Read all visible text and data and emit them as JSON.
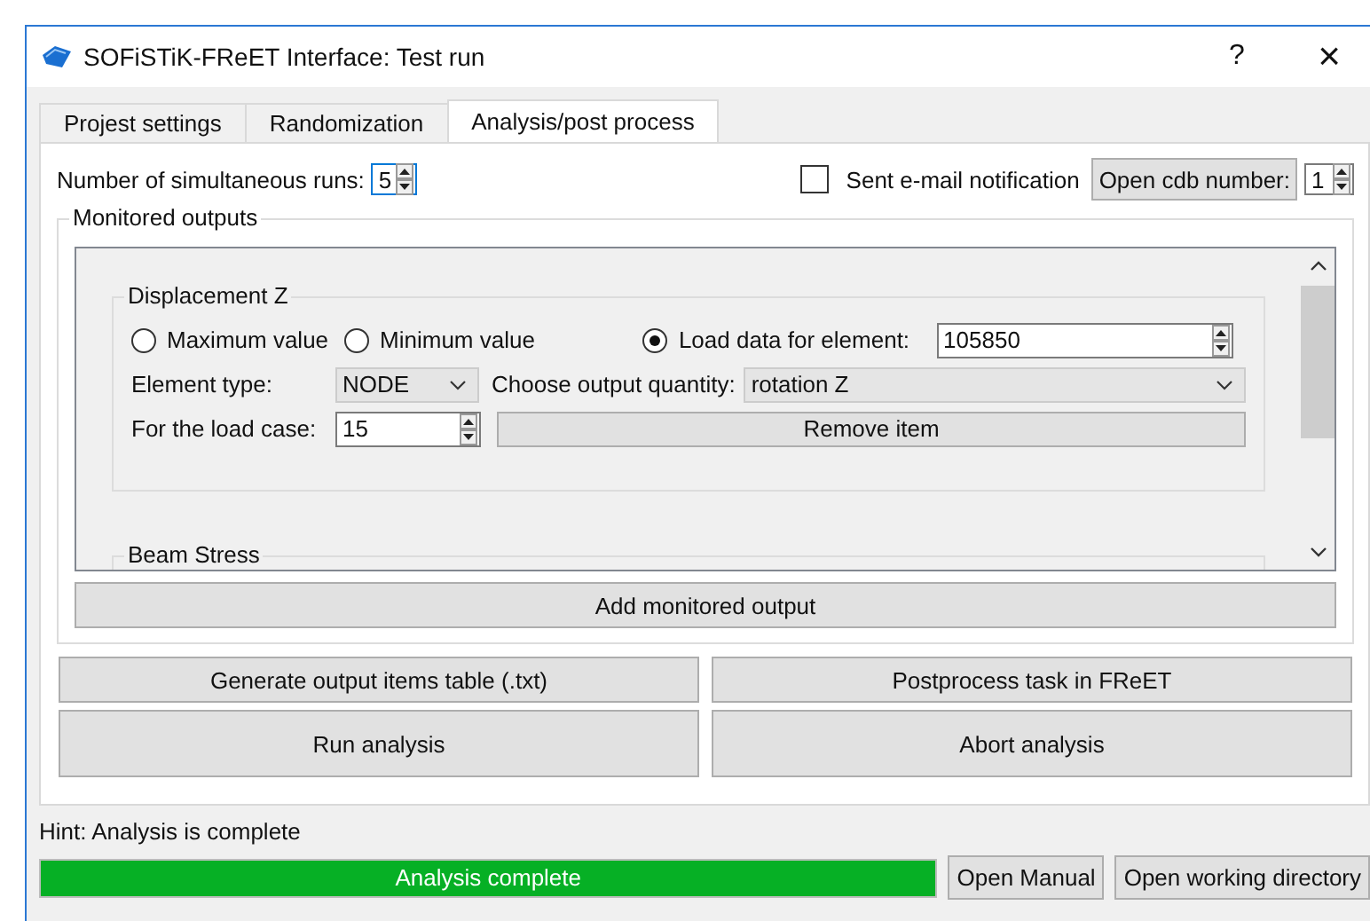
{
  "window": {
    "title": "SOFiSTiK-FReET Interface: Test run",
    "help": "?",
    "close": "×"
  },
  "tabs": [
    {
      "label": "Projest settings",
      "selected": false
    },
    {
      "label": "Randomization",
      "selected": false
    },
    {
      "label": "Analysis/post process",
      "selected": true
    }
  ],
  "runs": {
    "label": "Number of simultaneous runs:",
    "value": "5"
  },
  "email": {
    "label": "Sent e-mail notification",
    "checked": false
  },
  "cdb": {
    "button": "Open cdb number:",
    "value": "1"
  },
  "monitored": {
    "title": "Monitored outputs",
    "items": [
      {
        "title": "Displacement Z",
        "options": [
          {
            "label": "Maximum value",
            "selected": false
          },
          {
            "label": "Minimum value",
            "selected": false
          },
          {
            "label": "Load data for element:",
            "selected": true
          }
        ],
        "element": "105850",
        "element_type_label": "Element type:",
        "element_type": "NODE",
        "quantity_label": "Choose output quantity:",
        "quantity": "rotation Z",
        "load_case_label": "For the load case:",
        "load_case": "15",
        "remove": "Remove item"
      },
      {
        "title": "Beam Stress"
      }
    ],
    "add": "Add monitored output"
  },
  "actions": [
    "Generate output items table (.txt)",
    "Postprocess task in FReET",
    "Run analysis",
    "Abort analysis"
  ],
  "hint": "Hint: Analysis is complete",
  "progress": {
    "text": "Analysis complete",
    "level": 1
  },
  "buttons": [
    "Open Manual",
    "Open working directory"
  ]
}
